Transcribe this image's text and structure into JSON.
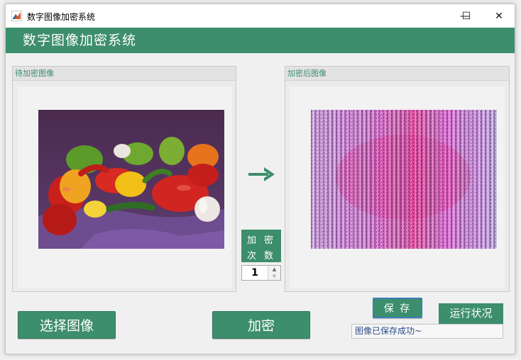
{
  "window": {
    "title": "数字图像加密系统",
    "controls": {
      "minimize": "—",
      "maximize": "☐",
      "close": "✕"
    }
  },
  "banner": {
    "title": "数字图像加密系统"
  },
  "left_panel": {
    "title": "待加密图像"
  },
  "right_panel": {
    "title": "加密后图像"
  },
  "arrow": "→",
  "count": {
    "label_chars": [
      "加",
      "密",
      "次",
      "数"
    ],
    "value": "1"
  },
  "buttons": {
    "select_image": "选择图像",
    "encrypt": "加密",
    "save": "保 存"
  },
  "status": {
    "label": "运行状况",
    "message": "图像已保存成功~"
  },
  "colors": {
    "accent": "#3d8e6c",
    "accent_text": "#ffffff",
    "status_text": "#2b4a86"
  },
  "icons": {
    "app": "matlab-icon",
    "arrow": "right-arrow-icon"
  }
}
